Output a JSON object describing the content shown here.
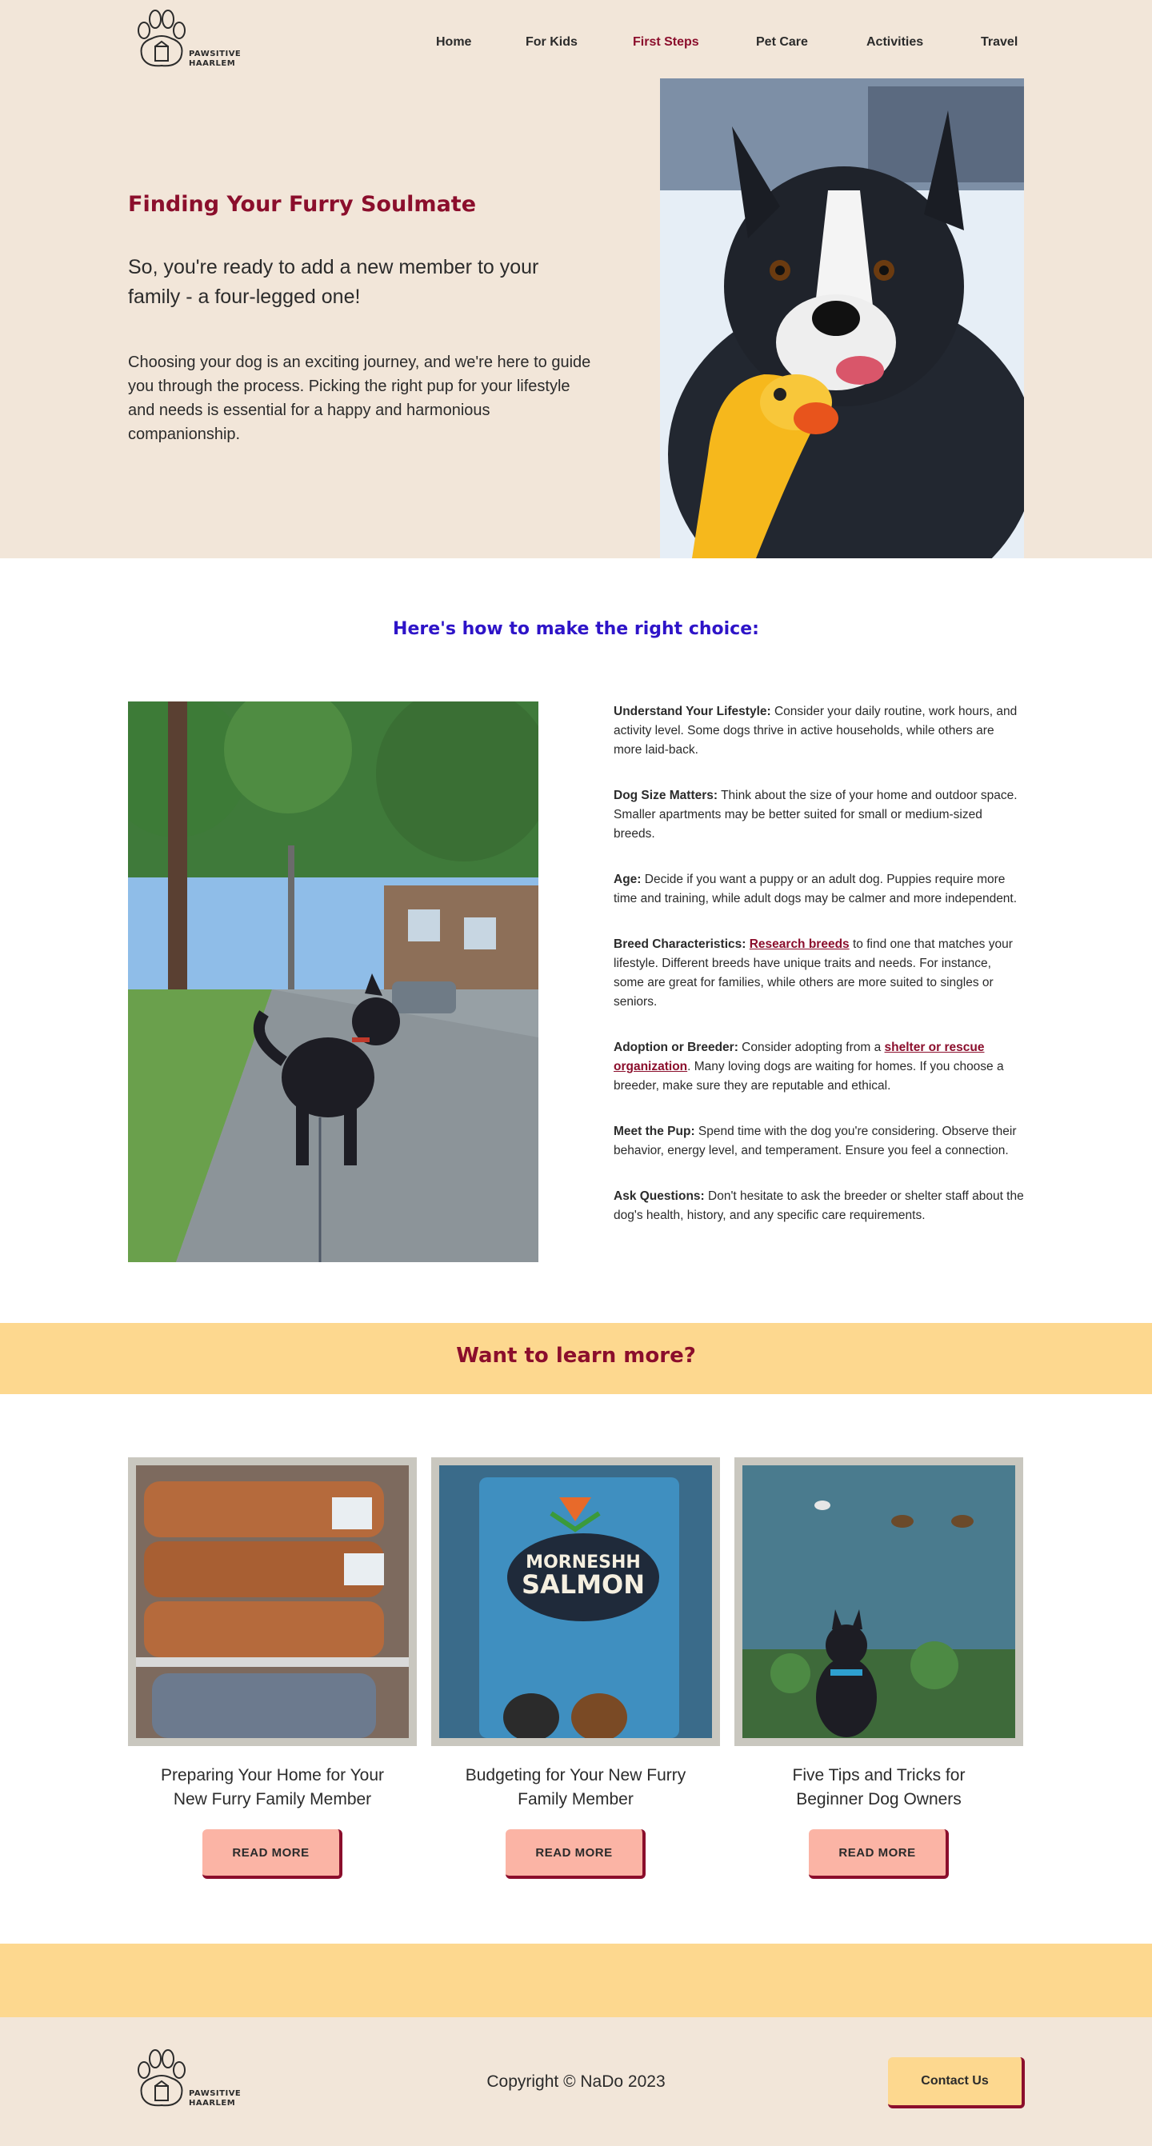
{
  "brand": {
    "logo_line1": "PAWSITIVE",
    "logo_line2": "HAARLEM"
  },
  "nav": {
    "items": [
      {
        "label": "Home"
      },
      {
        "label": "For Kids"
      },
      {
        "label": "First Steps",
        "active": true
      },
      {
        "label": "Pet Care"
      },
      {
        "label": "Activities"
      },
      {
        "label": "Travel"
      }
    ]
  },
  "hero": {
    "title": "Finding Your Furry Soulmate",
    "subtitle": "So, you're ready to add a new member to your family - a four-legged one!",
    "body": "Choosing your dog is an exciting journey, and we're here to guide you through the process. Picking the right pup for your lifestyle and needs is essential for a happy and harmonious companionship."
  },
  "choice": {
    "title": "Here's how to make the right choice:",
    "tips": [
      {
        "heading": "Understand Your Lifestyle:",
        "text": " Consider your daily routine, work hours, and activity level. Some dogs thrive in active households, while others are more laid-back."
      },
      {
        "heading": "Dog Size Matters:",
        "text": " Think about the size of your home and outdoor space. Smaller apartments may be better suited for small or medium-sized breeds."
      },
      {
        "heading": "Age:",
        "text": " Decide if you want a puppy or an adult dog. Puppies require more time and training, while adult dogs may be calmer and more independent."
      },
      {
        "heading": "Breed Characteristics:",
        "pre": " ",
        "link": "Research breeds",
        "text": " to find one that matches your lifestyle. Different breeds have unique traits and needs. For instance, some are great for families, while others are more suited to singles or seniors."
      },
      {
        "heading": "Adoption or Breeder:",
        "pre": " Consider adopting from a ",
        "link": "shelter or rescue organization",
        "text": ". Many loving dogs are waiting for homes. If you choose a breeder, make sure they are reputable and ethical."
      },
      {
        "heading": "Meet the Pup:",
        "text": " Spend time with the dog you're considering. Observe their behavior, energy level, and temperament. Ensure you feel a connection."
      },
      {
        "heading": "Ask Questions:",
        "text": " Don't hesitate to ask the breeder or shelter staff about the dog's health, history, and any specific care requirements."
      }
    ]
  },
  "learn": {
    "title": "Want to learn more?"
  },
  "cards": [
    {
      "title": "Preparing Your Home for Your New Furry  Family Member",
      "button": "READ MORE"
    },
    {
      "title": "Budgeting for Your New Furry Family Member",
      "button": "READ MORE",
      "bag_text_1": "MORNESHH",
      "bag_text_2": "SALMON"
    },
    {
      "title": "Five Tips and Tricks for Beginner Dog Owners",
      "button": "READ MORE"
    }
  ],
  "footer": {
    "copyright": "Copyright © NaDo 2023",
    "contact": "Contact Us"
  },
  "colors": {
    "cream": "#f2e6d9",
    "burgundy": "#8b0e2c",
    "yellow": "#fdd88f",
    "blue_heading": "#2e14c8",
    "salmon_button": "#fbb4a5"
  }
}
